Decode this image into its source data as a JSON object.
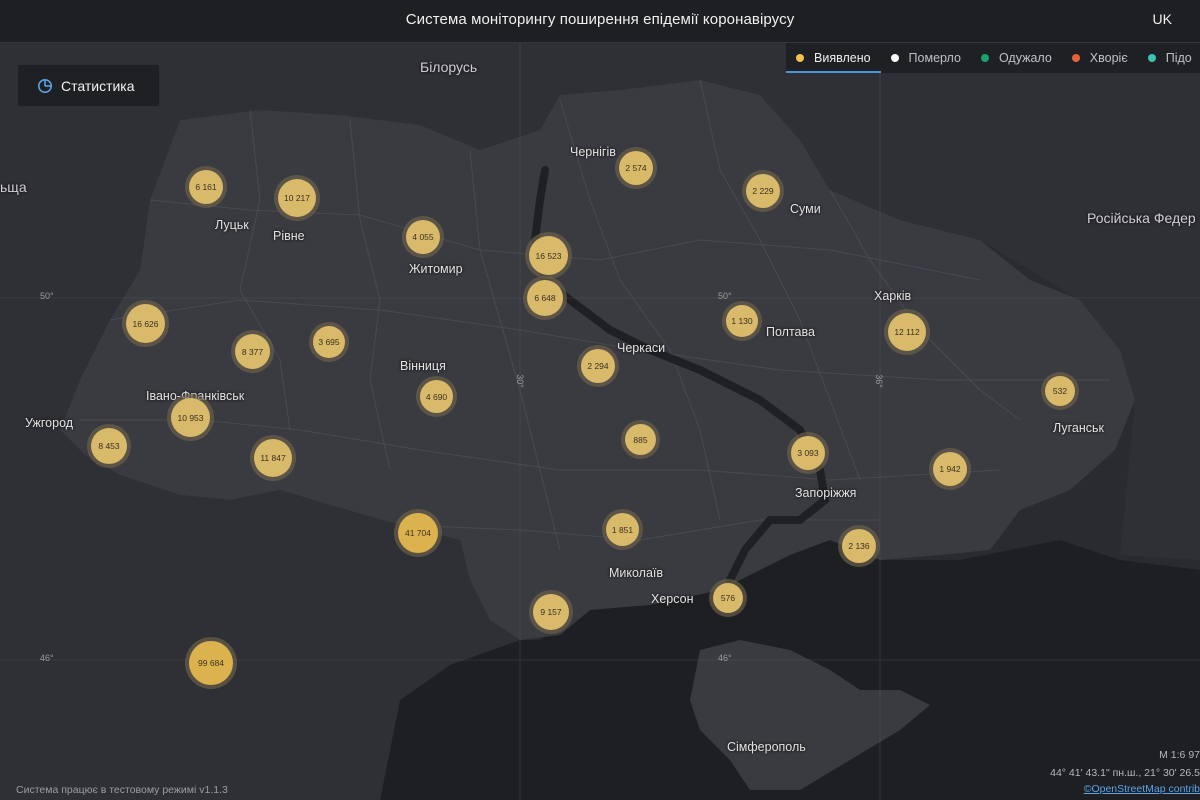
{
  "header": {
    "title": "Система моніторингу поширення епідемії коронавірусу",
    "lang": "UK"
  },
  "stats_button": {
    "label": "Статистика"
  },
  "legend": [
    {
      "label": "Виявлено",
      "color": "#f2c14e",
      "active": true
    },
    {
      "label": "Померло",
      "color": "#ffffff",
      "active": false
    },
    {
      "label": "Одужало",
      "color": "#1aa36b",
      "active": false
    },
    {
      "label": "Хворіє",
      "color": "#e8623c",
      "active": false
    },
    {
      "label": "Підо",
      "color": "#3ec1b2",
      "active": false
    }
  ],
  "places": {
    "belarus": "Білорусь",
    "russia": "Російська Федер",
    "poland_edge": "ьща",
    "lutsk": "Луцьк",
    "rivne": "Рівне",
    "zhytomyr": "Житомир",
    "chernihiv": "Чернігів",
    "sumy": "Суми",
    "kharkiv": "Харків",
    "poltava": "Полтава",
    "cherkasy": "Черкаси",
    "vinnytsia": "Вінниця",
    "ivano_frankivsk": "Івано-Франківськ",
    "uzhhorod": "Ужгород",
    "luhansk": "Луганськ",
    "zaporizhzhia": "Запоріжжя",
    "mykolaiv": "Миколаїв",
    "kherson": "Херсон",
    "simferopol": "Сімферополь"
  },
  "grid": {
    "lat50_left": "50°",
    "lat50_mid": "50°",
    "lat46_left": "46°",
    "lat46_mid": "46°",
    "lon30": "30°",
    "lon36": "36°"
  },
  "clusters": {
    "c1": "6 161",
    "c2": "10 217",
    "c3": "4 055",
    "c4": "16 523",
    "c5": "6 648",
    "c6": "2 574",
    "c7": "2 229",
    "c8": "16 626",
    "c9": "8 377",
    "c10": "3 695",
    "c11": "1 130",
    "c12": "12 112",
    "c13": "2 294",
    "c14": "10 953",
    "c15": "4 690",
    "c16": "8 453",
    "c17": "11 847",
    "c18": "532",
    "c19": "885",
    "c20": "3 093",
    "c21": "1 942",
    "c22": "41 704",
    "c23": "1 851",
    "c24": "2 136",
    "c25": "576",
    "c26": "9 157",
    "c27": "99 684"
  },
  "footer": {
    "version": "Система працює в тестовому режимі v1.1.3",
    "scale": "М 1:6 97",
    "coords": "44° 41' 43.1\" пн.ш., 21° 30' 26.5",
    "attribution": "©OpenStreetMap contrib"
  }
}
